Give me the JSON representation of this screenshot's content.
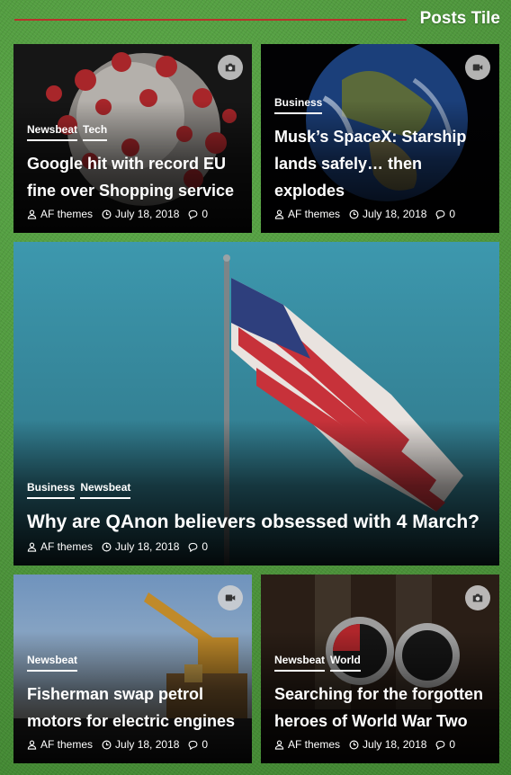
{
  "section": {
    "title": "Posts Tile"
  },
  "posts": [
    {
      "categories": [
        "Newsbeat",
        "Tech"
      ],
      "title": "Google hit with record EU fine over Shopping service",
      "author": "AF themes",
      "date": "July 18, 2018",
      "comments": "0",
      "media_icon": "camera-icon"
    },
    {
      "categories": [
        "Business"
      ],
      "title": "Musk’s SpaceX: Starship lands safely… then explodes",
      "author": "AF themes",
      "date": "July 18, 2018",
      "comments": "0",
      "media_icon": "video-icon"
    },
    {
      "categories": [
        "Business",
        "Newsbeat"
      ],
      "title": "Why are QAnon believers obsessed with 4 March?",
      "author": "AF themes",
      "date": "July 18, 2018",
      "comments": "0"
    },
    {
      "categories": [
        "Newsbeat"
      ],
      "title": "Fisherman swap petrol motors for electric engines",
      "author": "AF themes",
      "date": "July 18, 2018",
      "comments": "0",
      "media_icon": "video-icon"
    },
    {
      "categories": [
        "Newsbeat",
        "World"
      ],
      "title": "Searching for the forgotten heroes of World War Two",
      "author": "AF themes",
      "date": "July 18, 2018",
      "comments": "0",
      "media_icon": "camera-icon"
    }
  ],
  "colors": {
    "accent_line": "#b8322a",
    "grass": "#4f9a3d"
  }
}
